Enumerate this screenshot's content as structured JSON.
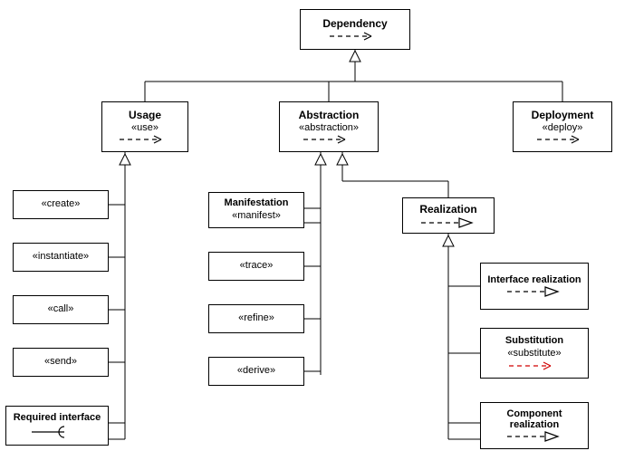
{
  "nodes": {
    "dependency": {
      "title": "Dependency",
      "stereotype": "",
      "arrowKind": "dashed-open",
      "arrowColor": "#000"
    },
    "usage": {
      "title": "Usage",
      "stereotype": "«use»",
      "arrowKind": "dashed-open",
      "arrowColor": "#000"
    },
    "abstraction": {
      "title": "Abstraction",
      "stereotype": "«abstraction»",
      "arrowKind": "dashed-open",
      "arrowColor": "#000"
    },
    "deployment": {
      "title": "Deployment",
      "stereotype": "«deploy»",
      "arrowKind": "dashed-open",
      "arrowColor": "#000"
    },
    "create": {
      "title": "",
      "stereotype": "«create»",
      "arrowKind": "",
      "arrowColor": ""
    },
    "instantiate": {
      "title": "",
      "stereotype": "«instantiate»",
      "arrowKind": "",
      "arrowColor": ""
    },
    "call": {
      "title": "",
      "stereotype": "«call»",
      "arrowKind": "",
      "arrowColor": ""
    },
    "send": {
      "title": "",
      "stereotype": "«send»",
      "arrowKind": "",
      "arrowColor": ""
    },
    "required_interface": {
      "title": "Required interface",
      "stereotype": "",
      "arrowKind": "req-iface",
      "arrowColor": "#000"
    },
    "manifestation": {
      "title": "Manifestation",
      "stereotype": "«manifest»",
      "arrowKind": "",
      "arrowColor": ""
    },
    "trace": {
      "title": "",
      "stereotype": "«trace»",
      "arrowKind": "",
      "arrowColor": ""
    },
    "refine": {
      "title": "",
      "stereotype": "«refine»",
      "arrowKind": "",
      "arrowColor": ""
    },
    "derive": {
      "title": "",
      "stereotype": "«derive»",
      "arrowKind": "",
      "arrowColor": ""
    },
    "realization": {
      "title": "Realization",
      "stereotype": "",
      "arrowKind": "dashed-hollow",
      "arrowColor": "#000"
    },
    "interface_realization": {
      "title": "Interface realization",
      "stereotype": "",
      "arrowKind": "dashed-hollow",
      "arrowColor": "#000"
    },
    "substitution": {
      "title": "Substitution",
      "stereotype": "«substitute»",
      "arrowKind": "dashed-open",
      "arrowColor": "#d00000"
    },
    "component_realization": {
      "title": "Component realization",
      "stereotype": "",
      "arrowKind": "dashed-hollow",
      "arrowColor": "#000"
    }
  },
  "hierarchy": {
    "Dependency": [
      "Usage",
      "Abstraction",
      "Deployment"
    ],
    "Usage": [
      "«create»",
      "«instantiate»",
      "«call»",
      "«send»",
      "Required interface"
    ],
    "Abstraction": [
      "Manifestation",
      "«trace»",
      "«refine»",
      "«derive»",
      "Realization"
    ],
    "Realization": [
      "Interface realization",
      "Substitution",
      "Component realization"
    ]
  },
  "arrowKinds": {
    "dashed-open": "dashed line, open arrowhead",
    "dashed-hollow": "dashed line, hollow triangle arrowhead",
    "req-iface": "solid line ending in half-circle (required interface socket)"
  }
}
